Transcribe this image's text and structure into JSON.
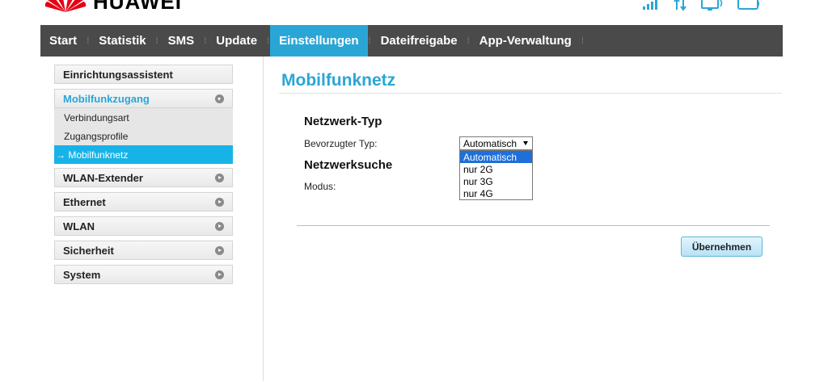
{
  "header": {
    "brand": "HUAWEI",
    "brand_color": "#e60012"
  },
  "status_icons": [
    "signal-icon",
    "data-transfer-icon",
    "monitor-icon",
    "battery-icon"
  ],
  "nav": {
    "items": [
      {
        "label": "Start",
        "active": false
      },
      {
        "label": "Statistik",
        "active": false
      },
      {
        "label": "SMS",
        "active": false
      },
      {
        "label": "Update",
        "active": false
      },
      {
        "label": "Einstellungen",
        "active": true
      },
      {
        "label": "Dateifreigabe",
        "active": false
      },
      {
        "label": "App-Verwaltung",
        "active": false
      }
    ],
    "bg_color": "#4a4a4a",
    "active_color": "#2aa6d6"
  },
  "sidebar": {
    "setup_wizard": "Einrichtungsassistent",
    "mobile_access": "Mobilfunkzugang",
    "sub_items": [
      "Verbindungsart",
      "Zugangsprofile",
      "→ Mobilfunknetz"
    ],
    "wlan_extender": "WLAN-Extender",
    "ethernet": "Ethernet",
    "wlan": "WLAN",
    "security": "Sicherheit",
    "system": "System"
  },
  "main": {
    "title": "Mobilfunknetz",
    "network_type": {
      "heading": "Netzwerk-Typ",
      "label": "Bevorzugter Typ:",
      "selected": "Automatisch",
      "options": [
        "Automatisch",
        "nur 2G",
        "nur 3G",
        "nur 4G"
      ]
    },
    "network_search": {
      "heading": "Netzwerksuche",
      "label": "Modus:"
    },
    "apply_label": "Übernehmen"
  }
}
